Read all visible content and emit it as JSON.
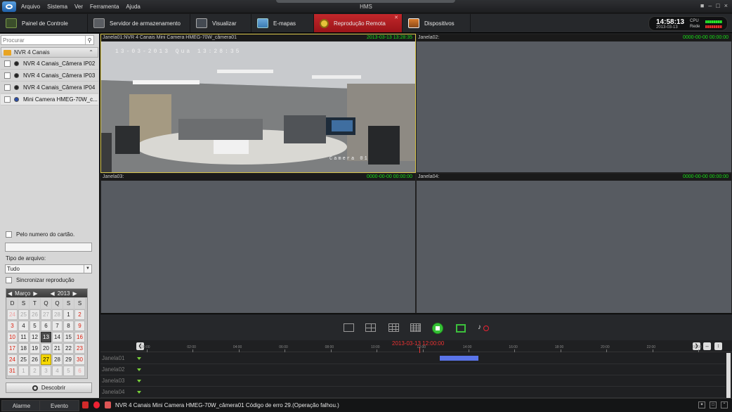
{
  "app": {
    "title": "HMS"
  },
  "menu": [
    "Arquivo",
    "Sistema",
    "Ver",
    "Ferramenta",
    "Ajuda"
  ],
  "tabs": [
    {
      "label": "Painel de Controle",
      "icon": "dashboard-icon"
    },
    {
      "label": "Servidor de armazenamento",
      "icon": "storage-server-icon"
    },
    {
      "label": "Visualizar",
      "icon": "monitor-icon"
    },
    {
      "label": "E-mapas",
      "icon": "map-icon"
    },
    {
      "label": "Reprodução Remota",
      "icon": "playback-icon",
      "active": true
    },
    {
      "label": "Dispositivos",
      "icon": "devices-icon"
    }
  ],
  "clock": {
    "time": "14:58:13",
    "date": "2013-03-13",
    "cpu_label": "CPU",
    "net_label": "Rede"
  },
  "sidebar": {
    "search_placeholder": "Procurar",
    "group": "NVR 4 Canais",
    "cameras": [
      {
        "label": "NVR 4 Canais_Câmera IP02",
        "selected": false
      },
      {
        "label": "NVR 4 Canais_Câmera IP03",
        "selected": false
      },
      {
        "label": "NVR 4 Canais_Câmera IP04",
        "selected": false
      },
      {
        "label": "Mini Camera HMEG-70W_c...",
        "selected": true
      }
    ],
    "card_option": "Pelo numero do cartão.",
    "file_type_label": "Tipo de arquivo:",
    "file_type_value": "Tudo",
    "sync_option": "Sincronizar reprodução",
    "find_button": "Descobrir"
  },
  "calendar": {
    "month": "Março",
    "year": "2013",
    "weekdays": [
      "D",
      "S",
      "T",
      "Q",
      "Q",
      "S",
      "S"
    ],
    "days": [
      [
        "24",
        "25",
        "26",
        "27",
        "28",
        "1",
        "2"
      ],
      [
        "3",
        "4",
        "5",
        "6",
        "7",
        "8",
        "9"
      ],
      [
        "10",
        "11",
        "12",
        "13",
        "14",
        "15",
        "16"
      ],
      [
        "17",
        "18",
        "19",
        "20",
        "21",
        "22",
        "23"
      ],
      [
        "24",
        "25",
        "26",
        "27",
        "28",
        "29",
        "30"
      ],
      [
        "31",
        "1",
        "2",
        "3",
        "4",
        "5",
        "6"
      ]
    ],
    "today": "13",
    "selected": "27"
  },
  "windows": [
    {
      "title": "Janela01:NVR 4 Canais Mini Camera HMEG-70W_câmera01",
      "timestamp": "2013-03-13 13:28:35",
      "osd": "13-03-2013 Qua 13:28:35",
      "osd_name": "Camera 01"
    },
    {
      "title": "Janela02:",
      "timestamp": "0000-00-00 00:00:00"
    },
    {
      "title": "Janela03:",
      "timestamp": "0000-00-00 00:00:00"
    },
    {
      "title": "Janela04:",
      "timestamp": "0000-00-00 00:00:00"
    }
  ],
  "timeline": {
    "current": "2013-03-13 12:00:00",
    "ticks": [
      "00:00",
      "02:00",
      "04:00",
      "06:00",
      "08:00",
      "10:00",
      "12:00",
      "14:00",
      "16:00",
      "18:00",
      "20:00",
      "22:00",
      "00:00"
    ],
    "rows": [
      "Janela01",
      "Janela02",
      "Janela03",
      "Janela04"
    ]
  },
  "status": {
    "alarm": "Alarme",
    "event": "Evento",
    "message": "NVR 4 Canais Mini Camera HMEG-70W_câmera01 Código de erro 29.(Operação falhou.)"
  },
  "colors": {
    "accent": "#c2272a",
    "ok": "#18e018",
    "record": "#5a74e8",
    "today": "#f6d800"
  }
}
